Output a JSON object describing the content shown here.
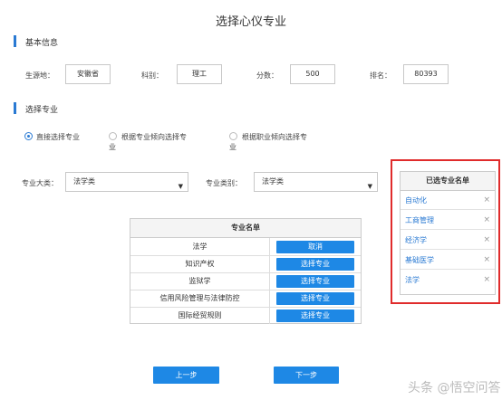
{
  "page_title": "选择心仪专业",
  "basic_info": {
    "section_label": "基本信息",
    "origin_label": "生源地：",
    "origin_value": "安徽省",
    "subject_label": "科别：",
    "subject_value": "理工",
    "score_label": "分数：",
    "score_value": "500",
    "rank_label": "排名：",
    "rank_value": "80393"
  },
  "choose_major": {
    "section_label": "选择专业",
    "radios": [
      {
        "label": "直接选择专业",
        "checked": true
      },
      {
        "label_line1": "根据专业倾向选择专",
        "label_line2": "业",
        "checked": false
      },
      {
        "label_line1": "根据职业倾向选择专",
        "label_line2": "业",
        "checked": false
      }
    ],
    "major_category_label": "专业大类：",
    "major_category_value": "法学类",
    "major_type_label": "专业类别：",
    "major_type_value": "法学类"
  },
  "major_list": {
    "header": "专业名单",
    "rows": [
      {
        "name": "法学",
        "action": "取消"
      },
      {
        "name": "知识产权",
        "action": "选择专业"
      },
      {
        "name": "监狱学",
        "action": "选择专业"
      },
      {
        "name": "信用风险管理与法律防控",
        "action": "选择专业"
      },
      {
        "name": "国际经贸规则",
        "action": "选择专业"
      }
    ]
  },
  "selected_panel": {
    "header": "已选专业名单",
    "items": [
      "自动化",
      "工商管理",
      "经济学",
      "基础医学",
      "法学"
    ],
    "remove_glyph": "×"
  },
  "nav": {
    "prev_label": "上一步",
    "next_label": "下一步"
  },
  "watermark": "头条 @悟空问答",
  "colors": {
    "accent": "#1e88e5",
    "highlight_frame": "#e02b2b"
  }
}
